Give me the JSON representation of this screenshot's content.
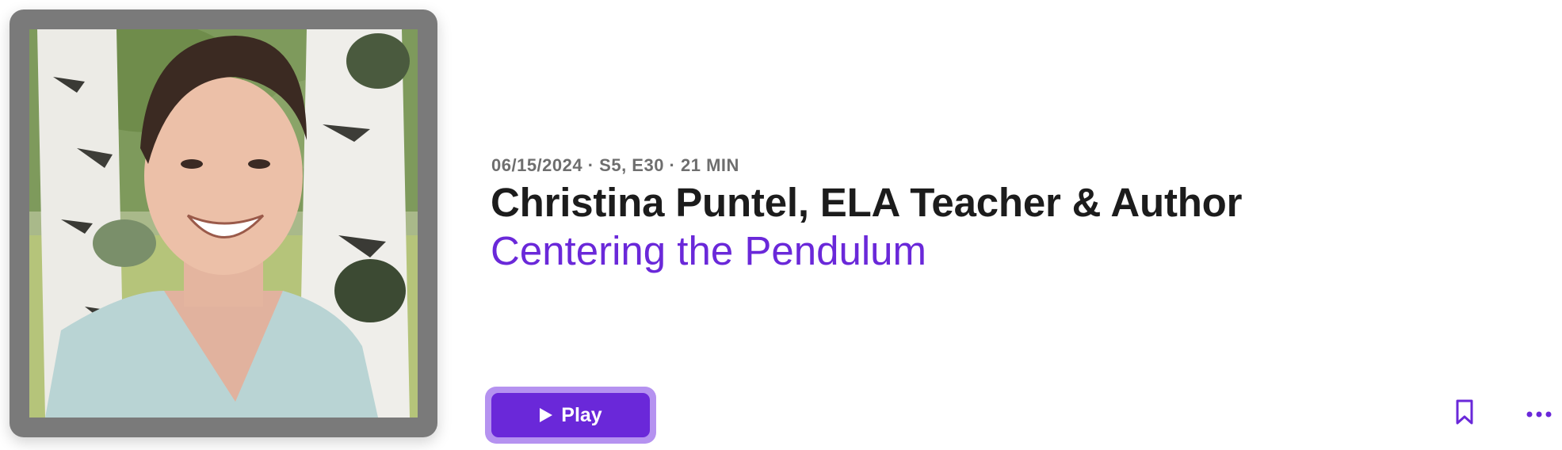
{
  "episode": {
    "meta": "06/15/2024 · S5, E30 · 21 MIN",
    "title": "Christina Puntel, ELA Teacher & Author",
    "show_name": "Centering the Pendulum"
  },
  "actions": {
    "play_label": "Play"
  },
  "icons": {
    "play": "play-icon",
    "bookmark": "bookmark-icon",
    "more": "more-icon"
  },
  "colors": {
    "accent": "#6a28d9",
    "accent_ring": "#b592f0",
    "meta_text": "#6e6e6e",
    "title_text": "#1c1c1c"
  }
}
